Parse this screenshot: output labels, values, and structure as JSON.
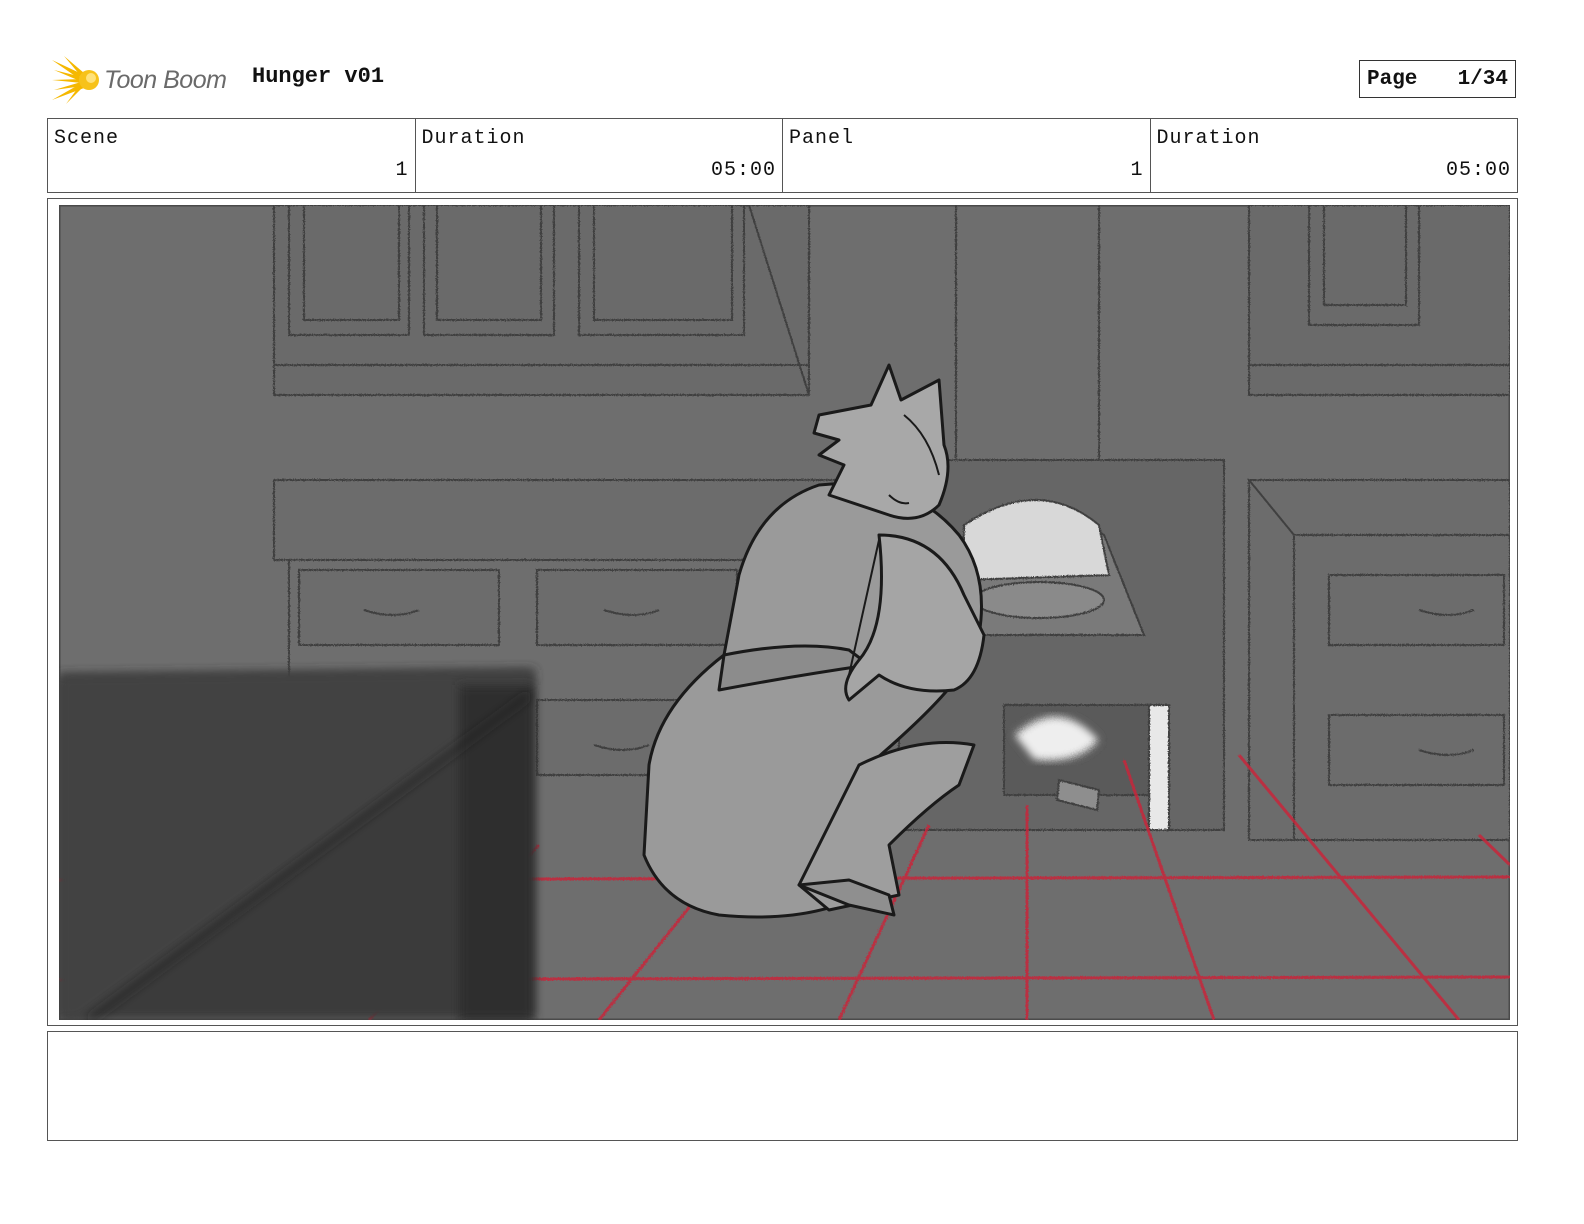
{
  "header": {
    "logo_text": "Toon Boom",
    "project_title": "Hunger v01",
    "page_label": "Page",
    "page_number": "1/34"
  },
  "info": {
    "scene_label": "Scene",
    "scene_value": "1",
    "scene_duration_label": "Duration",
    "scene_duration_value": "05:00",
    "panel_label": "Panel",
    "panel_value": "1",
    "panel_duration_label": "Duration",
    "panel_duration_value": "05:00"
  },
  "notes": {
    "text": ""
  },
  "colors": {
    "logo_accent": "#f5b800",
    "floor_grid": "#c8263a",
    "sketch_background": "#6e6e6e"
  }
}
